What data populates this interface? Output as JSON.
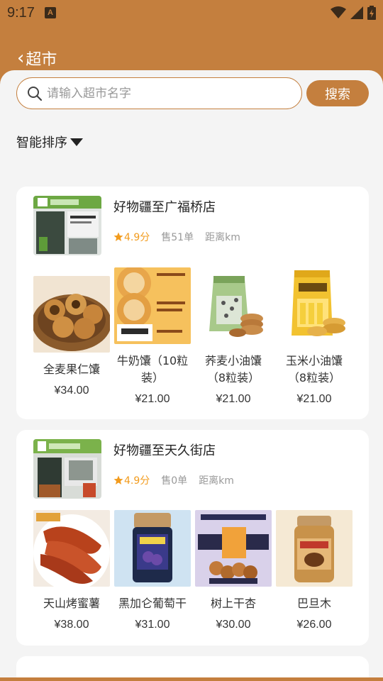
{
  "status": {
    "time": "9:17",
    "a_icon": "A"
  },
  "header": {
    "title": "超市"
  },
  "search": {
    "placeholder": "请输入超市名字",
    "button": "搜索"
  },
  "sort": {
    "label": "智能排序"
  },
  "stores": [
    {
      "name": "好物疆至广福桥店",
      "rating": "4.9分",
      "sales": "售51单",
      "distance": "距离km",
      "products": [
        {
          "name": "全麦果仁馕",
          "price": "¥34.00"
        },
        {
          "name": "牛奶馕（10粒装）",
          "price": "¥21.00"
        },
        {
          "name": "荞麦小油馕（8粒装）",
          "price": "¥21.00"
        },
        {
          "name": "玉米小油馕（8粒装）",
          "price": "¥21.00"
        }
      ]
    },
    {
      "name": "好物疆至天久街店",
      "rating": "4.9分",
      "sales": "售0单",
      "distance": "距离km",
      "products": [
        {
          "name": "天山烤蜜薯",
          "price": "¥38.00"
        },
        {
          "name": "黑加仑葡萄干",
          "price": "¥31.00"
        },
        {
          "name": "树上干杏",
          "price": "¥30.00"
        },
        {
          "name": "巴旦木",
          "price": "¥26.00"
        }
      ]
    }
  ],
  "colors": {
    "brand": "#c47f3e",
    "rating": "#f29b1d",
    "background": "#f4f4f4"
  }
}
